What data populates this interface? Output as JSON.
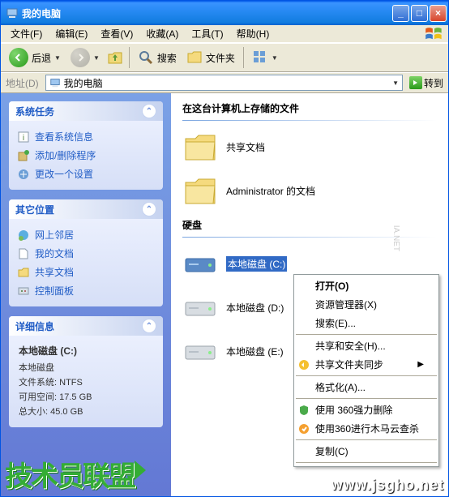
{
  "window": {
    "title": "我的电脑"
  },
  "menu": {
    "file": "文件(F)",
    "edit": "编辑(E)",
    "view": "查看(V)",
    "favorites": "收藏(A)",
    "tools": "工具(T)",
    "help": "帮助(H)"
  },
  "toolbar": {
    "back": "后退",
    "search": "搜索",
    "folders": "文件夹"
  },
  "address": {
    "label": "地址(D)",
    "value": "我的电脑",
    "go": "转到"
  },
  "sidebar": {
    "system_tasks": {
      "title": "系统任务",
      "items": [
        {
          "icon": "info-icon",
          "label": "查看系统信息"
        },
        {
          "icon": "add-remove-icon",
          "label": "添加/删除程序"
        },
        {
          "icon": "settings-icon",
          "label": "更改一个设置"
        }
      ]
    },
    "other_places": {
      "title": "其它位置",
      "items": [
        {
          "icon": "network-icon",
          "label": "网上邻居"
        },
        {
          "icon": "documents-icon",
          "label": "我的文档"
        },
        {
          "icon": "shared-icon",
          "label": "共享文档"
        },
        {
          "icon": "control-panel-icon",
          "label": "控制面板"
        }
      ]
    },
    "details": {
      "title": "详细信息",
      "drive_name": "本地磁盘  (C:)",
      "drive_type": "本地磁盘",
      "filesystem_label": "文件系统:",
      "filesystem_value": "NTFS",
      "free_label": "可用空间:",
      "free_value": "17.5 GB",
      "total_label": "总大小:",
      "total_value": "45.0 GB"
    }
  },
  "main": {
    "section_files": "在这台计算机上存储的文件",
    "shared_docs": "共享文档",
    "admin_docs": "Administrator 的文档",
    "section_disks": "硬盘",
    "drive_c": "本地磁盘 (C:)",
    "drive_d": "本地磁盘 (D:)",
    "drive_e": "本地磁盘 (E:)"
  },
  "context_menu": {
    "open": "打开(O)",
    "explorer": "资源管理器(X)",
    "search": "搜索(E)...",
    "sharing": "共享和安全(H)...",
    "sync": "共享文件夹同步",
    "format": "格式化(A)...",
    "del360": "使用 360强力删除",
    "scan360": "使用360进行木马云查杀",
    "copy": "复制(C)"
  },
  "watermark": {
    "logo": "技术员联盟",
    "url": "www.jsgho.net",
    "faint": "IA.NET"
  }
}
